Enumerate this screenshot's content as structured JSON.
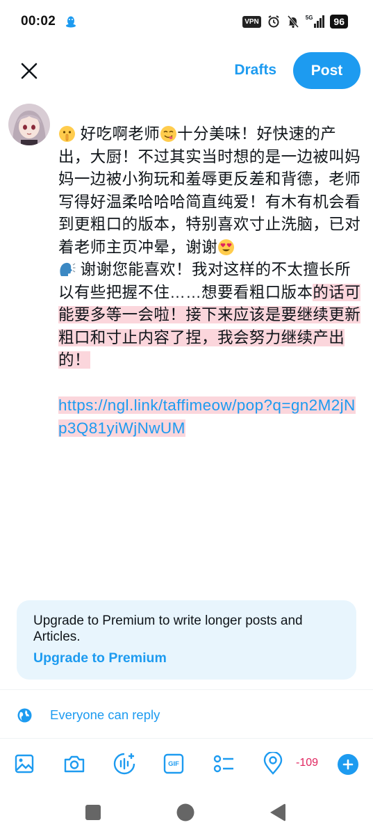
{
  "status_bar": {
    "time": "00:02",
    "vpn_label": "VPN",
    "network_label": "5G",
    "battery": "96",
    "icons": [
      "qq-penguin-icon",
      "alarm-icon",
      "mute-icon",
      "signal-icon"
    ]
  },
  "header": {
    "close_icon": "close-icon",
    "drafts_label": "Drafts",
    "post_label": "Post"
  },
  "composer": {
    "avatar": "user-avatar",
    "p1_emoji1": "shushing-face-emoji",
    "p1_text_a": " 好吃啊老师",
    "p1_emoji2": "savoring-food-emoji",
    "p1_text_b": "十分美味！好快速的产出，大厨！不过其实当时想的是一边被叫妈妈一边被小狗玩和羞辱更反差和背德，老师写得好温柔哈哈哈简直纯爱！有木有机会看到更粗口的版本，特别喜欢寸止洗脑，已对着老师主页冲晕，谢谢",
    "p1_emoji3": "heart-eyes-emoji",
    "p2_emoji": "speaking-head-emoji",
    "p2_text_plain": " 谢谢您能喜欢！我对这样的不太擅长所以有些把握不住……想要看粗口版本",
    "p2_text_highlight": "的话可能要多等一会啦！接下来应该是要继续更新粗口和寸止内容了捏，我会努力继续产出的！",
    "link": "https://ngl.link/taffimeow/pop?q=gn2M2jNp3Q81yiWjNwUM"
  },
  "upgrade": {
    "message": "Upgrade to Premium to write longer posts and Articles.",
    "link_label": "Upgrade to Premium"
  },
  "reply_setting": {
    "icon": "globe-icon",
    "label": "Everyone can reply"
  },
  "toolbar": {
    "tools": [
      "image-icon",
      "camera-icon",
      "voice-icon",
      "gif-icon",
      "poll-icon",
      "location-icon"
    ],
    "gif_label": "GIF",
    "char_count": "-109",
    "add_icon": "plus-icon"
  },
  "nav_bar": {
    "buttons": [
      "recents-square-icon",
      "home-circle-icon",
      "back-triangle-icon"
    ]
  },
  "colors": {
    "accent": "#1d9bf0",
    "highlight": "#fbd6dc",
    "overflow_count": "#e0245e",
    "card_bg": "#e8f5fd"
  }
}
